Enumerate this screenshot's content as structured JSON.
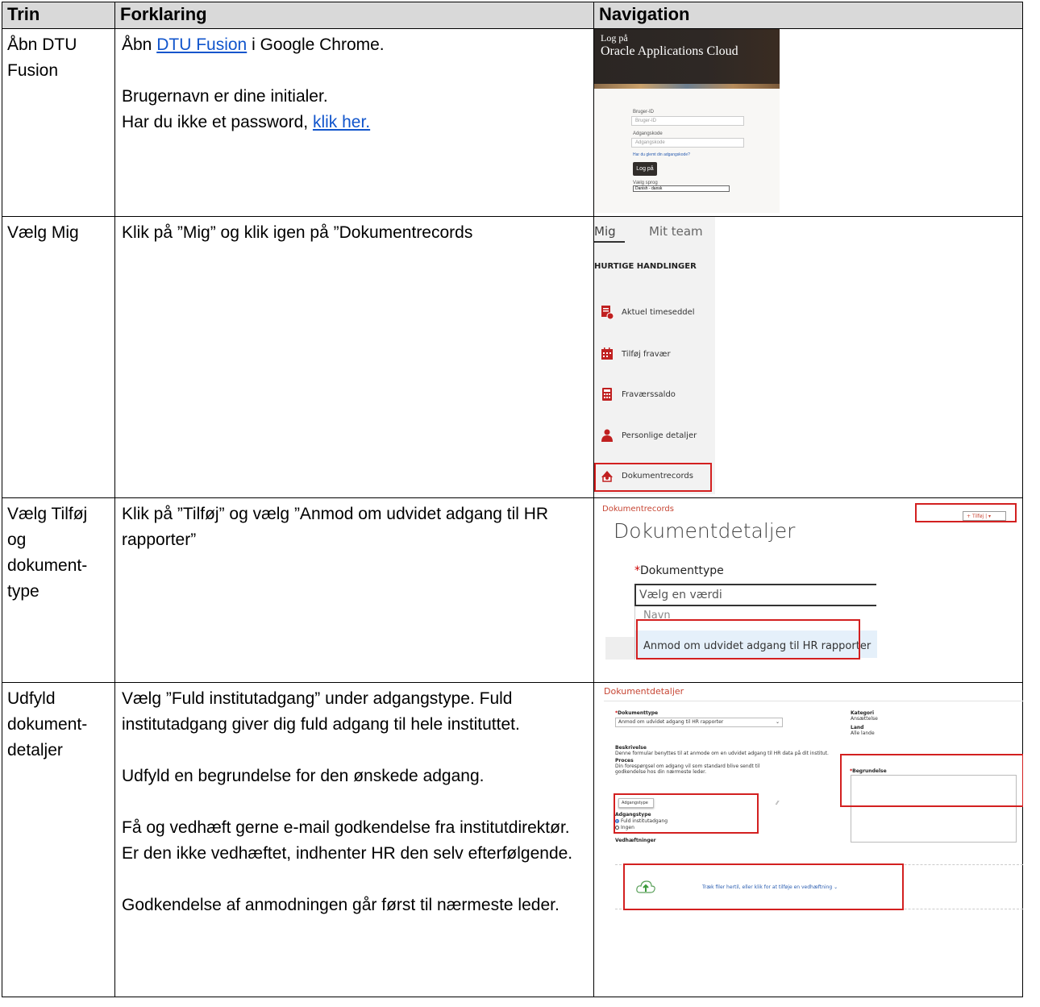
{
  "headers": {
    "trin": "Trin",
    "forklaring": "Forklaring",
    "navigation": "Navigation"
  },
  "rows": [
    {
      "trin": "Åbn DTU Fusion",
      "p1_pre": "Åbn ",
      "p1_link": "DTU Fusion",
      "p1_post": " i Google Chrome.",
      "p2": "Brugernavn er dine initialer.",
      "p3_pre": "Har du ikke et password, ",
      "p3_link": "klik her."
    },
    {
      "trin": "Vælg Mig",
      "p1": "Klik på ”Mig” og klik igen på ”Dokumentrecords"
    },
    {
      "trin": "Vælg Tilføj og dokument-type",
      "p1": "Klik på ”Tilføj” og vælg ”Anmod om udvidet adgang til HR rapporter”"
    },
    {
      "trin": "Udfyld dokument-detaljer",
      "p1": "Vælg ”Fuld institutadgang” under adgangstype. Fuld institutadgang giver dig fuld adgang til hele instituttet.",
      "p2": "Udfyld en begrundelse for den ønskede adgang.",
      "p3": "Få og vedhæft gerne e-mail godkendelse fra institutdirektør. Er den ikke vedhæftet, indhenter HR den selv efterfølgende.",
      "p4": "Godkendelse af anmodningen går først til nærmeste leder."
    }
  ],
  "login": {
    "title1": "Log på",
    "title2": "Oracle Applications Cloud",
    "user_label": "Bruger-ID",
    "user_placeholder": "Bruger-ID",
    "pass_label": "Adgangskode",
    "pass_placeholder": "Adgangskode",
    "forgot": "Har du glemt din adgangskode?",
    "button": "Log på",
    "lang_label": "Vælg sprog",
    "lang_value": "Danish - dansk"
  },
  "mig": {
    "tab_me": "Mig",
    "tab_team": "Mit team",
    "section": "HURTIGE HANDLINGER",
    "items": [
      "Aktuel timeseddel",
      "Tilføj fravær",
      "Fraværssaldo",
      "Personlige detaljer",
      "Dokumentrecords"
    ]
  },
  "dok": {
    "crumb": "Dokumentrecords",
    "title": "Dokumentdetaljer",
    "add_button": "Tilføj",
    "field_label": "Dokumenttype",
    "placeholder": "Vælg en værdi",
    "opt_name": "Navn",
    "opt_request": "Anmod om udvidet adgang til HR rapporter"
  },
  "form": {
    "title": "Dokumentdetaljer",
    "doctype_label": "Dokumenttype",
    "doctype_value": "Anmod om udvidet adgang til HR rapporter",
    "kategori_label": "Kategori",
    "kategori_value": "Ansættelse",
    "land_label": "Land",
    "land_value": "Alle lande",
    "beskrivelse_label": "Beskrivelse",
    "beskrivelse_value": "Denne formular benyttes til at anmode om en udvidet adgang til HR data på dit institut.",
    "proces_label": "Proces",
    "proces_value": "Din forespørgsel om adgang vil som standard blive sendt til godkendelse hos din nærmeste leder.",
    "begrundelse_label": "Begrundelse",
    "tooltip": "Adgangstype",
    "adgangstype_label": "Adgangstype",
    "opt_full": "Fuld institutadgang",
    "opt_none": "Ingen",
    "vedh_label": "Vedhæftninger",
    "drop_text": "Træk filer hertil, eller klik for at tilføje en vedhæftning"
  }
}
